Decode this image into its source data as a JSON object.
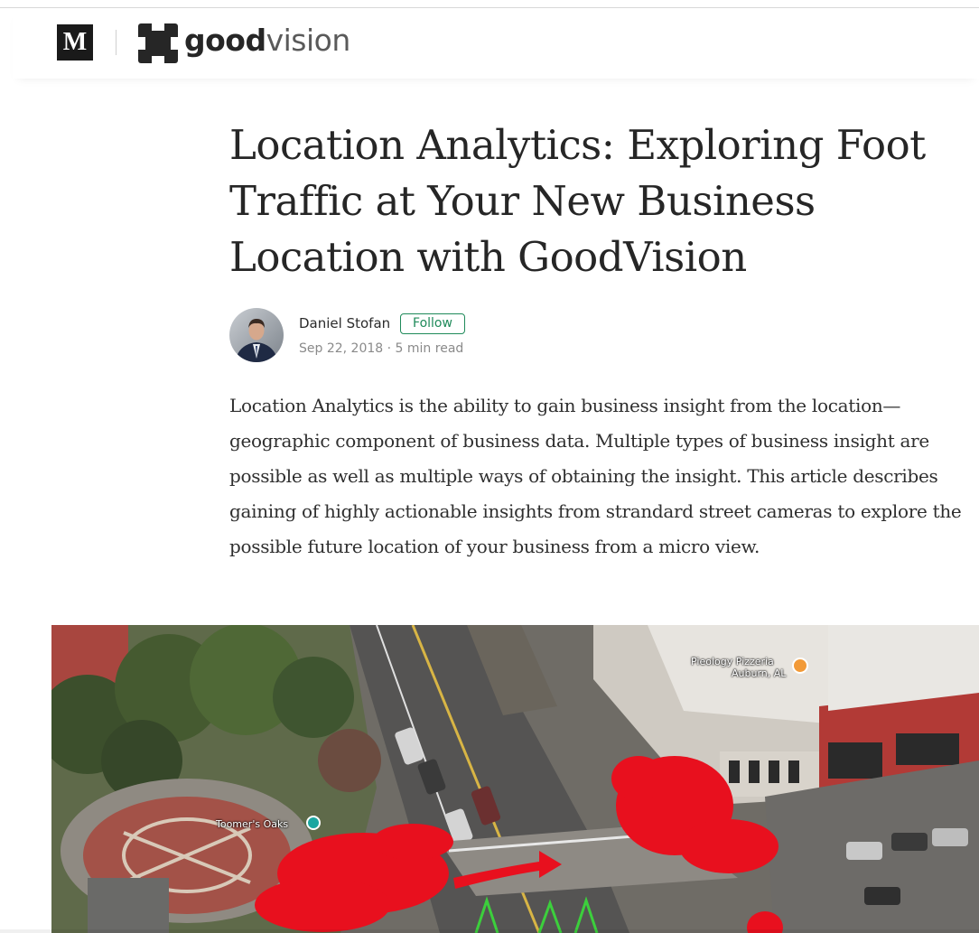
{
  "header": {
    "medium_logo": "M",
    "brand_bold": "good",
    "brand_light": "vision",
    "icons": {
      "publication": "goodvision-logo-icon"
    }
  },
  "article": {
    "title": "Location Analytics: Exploring Foot Traffic at Your New Business Location with GoodVision",
    "author": {
      "name": "Daniel Stofan",
      "follow_label": "Follow",
      "date": "Sep 22, 2018",
      "separator": "·",
      "read_time": "5 min read"
    },
    "intro": "Location Analytics is the ability to gain business insight from the location—geographic component of business data. Multiple types of business insight are possible as well as multiple ways of obtaining the insight. This article describes gaining of highly actionable insights from strandard street cameras to explore the possible future location of your business from a micro view."
  },
  "hero_image": {
    "labels": {
      "place_1_line1": "Pieology Pizzeria",
      "place_1_line2": "Auburn, AL",
      "place_2": "Toomer's Oaks"
    },
    "colors": {
      "annotation": "#e8101e",
      "arrow": "#3ccf3c"
    }
  },
  "colors": {
    "accent": "#1f8a5a",
    "text": "#262626",
    "muted": "#8a8a8a"
  }
}
